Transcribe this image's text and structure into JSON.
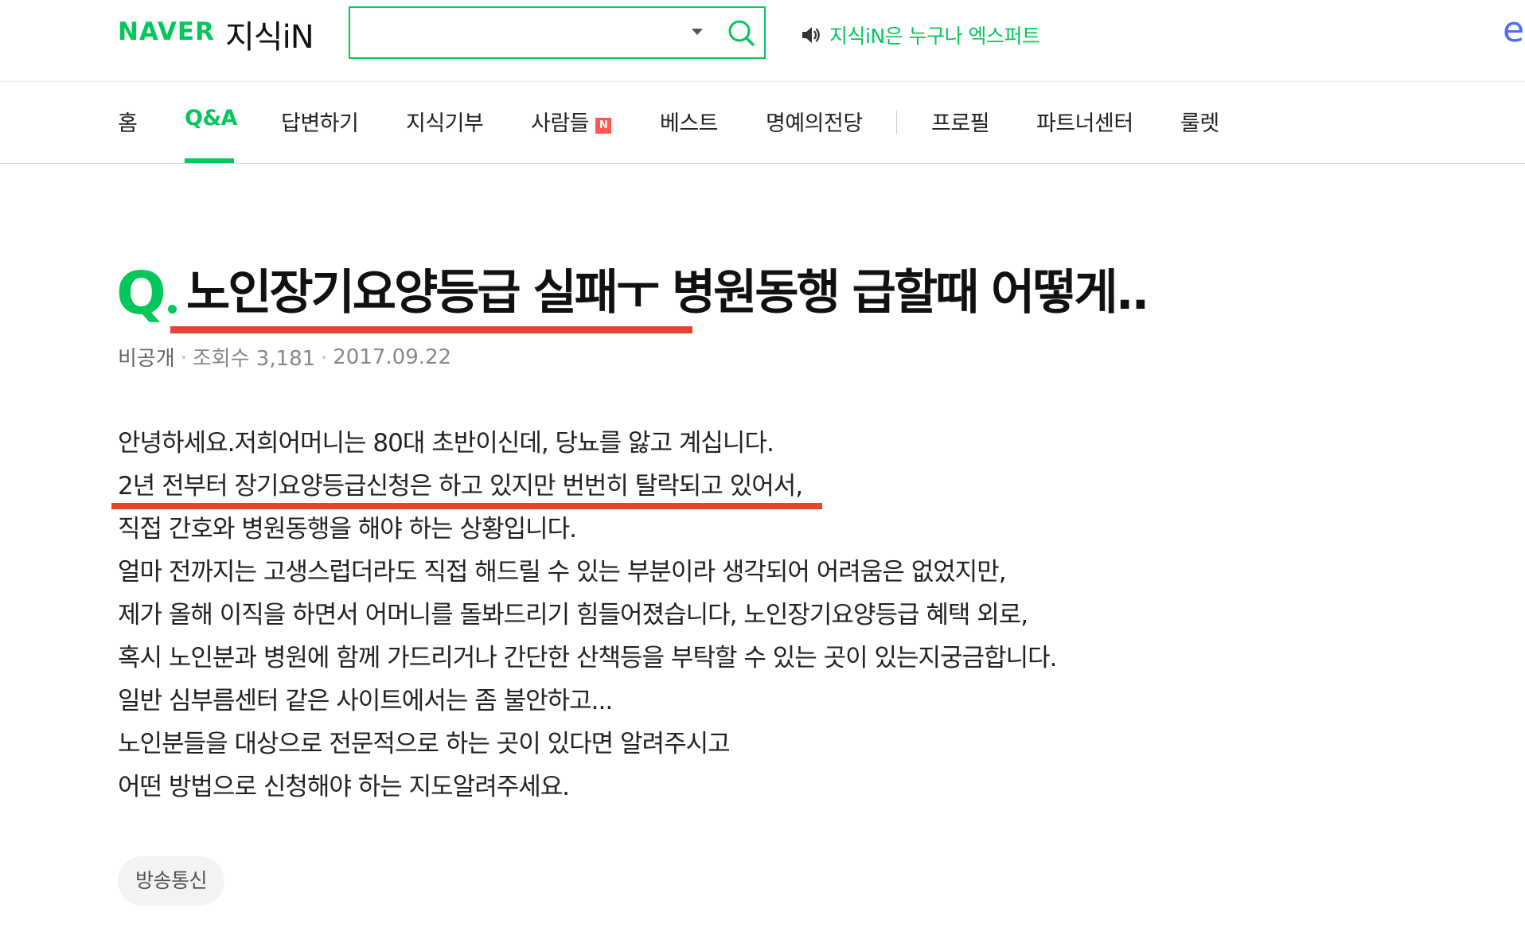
{
  "header": {
    "logo_naver": "NAVER",
    "logo_service": "지식iN",
    "search": {
      "value": "",
      "placeholder": ""
    },
    "notice_text": "지식iN은 누구나 엑스퍼트",
    "edge_letter": "e"
  },
  "gnb": {
    "items": [
      {
        "label": "홈"
      },
      {
        "label": "Q&A",
        "active": true
      },
      {
        "label": "답변하기"
      },
      {
        "label": "지식기부"
      },
      {
        "label": "사람들",
        "badge": "N"
      },
      {
        "label": "베스트"
      },
      {
        "label": "명예의전당"
      },
      {
        "label": "프로필"
      },
      {
        "label": "파트너센터"
      },
      {
        "label": "룰렛"
      }
    ]
  },
  "question": {
    "mark": "Q",
    "title": "노인장기요양등급 실패ㅜ 병원동행 급할때 어떻게..",
    "author": "비공개",
    "views": "조회수 3,181",
    "date": "2017.09.22",
    "body": [
      "안녕하세요.저희어머니는 80대 초반이신데, 당뇨를 앓고 계십니다.",
      "2년 전부터 장기요양등급신청은 하고 있지만 번번히 탈락되고 있어서,",
      "직접 간호와 병원동행을 해야 하는 상황입니다.",
      "얼마 전까지는 고생스럽더라도 직접 해드릴 수 있는 부분이라 생각되어 어려움은 없었지만,",
      "제가 올해 이직을 하면서 어머니를 돌봐드리기 힘들어졌습니다, 노인장기요양등급 혜택 외로,",
      "혹시 노인분과 병원에 함께 가드리거나 간단한 산책등을 부탁할 수 있는 곳이 있는지궁금합니다.",
      "일반 심부름센터 같은 사이트에서는 좀 불안하고...",
      "노인분들을 대상으로 전문적으로 하는 곳이 있다면 알려주시고",
      "어떤 방법으로 신청해야 하는 지도알려주세요."
    ],
    "tag": "방송통신"
  },
  "colors": {
    "brand_green": "#03c75a",
    "highlight_red": "#e8432f",
    "badge_red": "#ff5a4f"
  }
}
